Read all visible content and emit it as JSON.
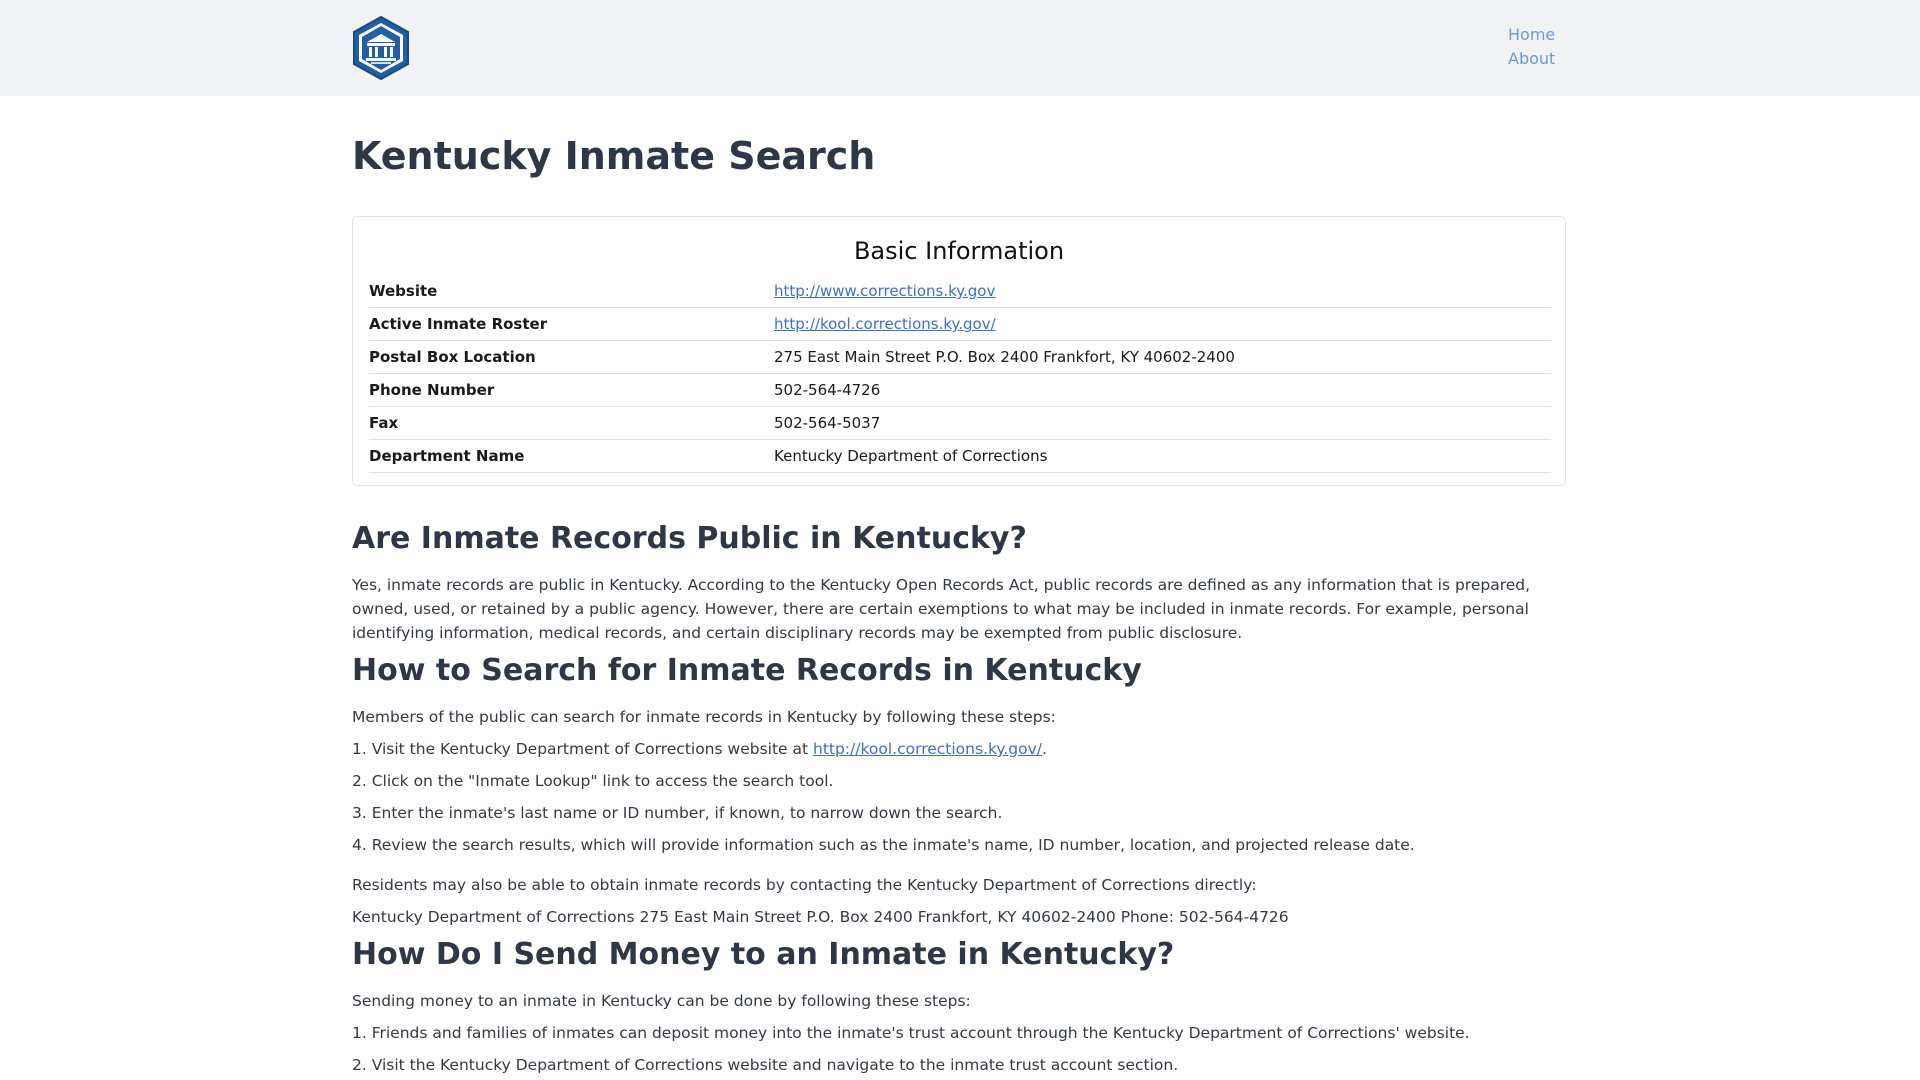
{
  "nav": {
    "logo_name": "site-logo",
    "links": [
      "Home",
      "About"
    ]
  },
  "page": {
    "title": "Kentucky Inmate Search"
  },
  "basic_info": {
    "heading": "Basic Information",
    "rows": [
      {
        "label": "Website",
        "value": "http://www.corrections.ky.gov",
        "link": true
      },
      {
        "label": "Active Inmate Roster",
        "value": "http://kool.corrections.ky.gov/",
        "link": true
      },
      {
        "label": "Postal Box Location",
        "value": "275 East Main Street P.O. Box 2400 Frankfort, KY 40602-2400",
        "link": false
      },
      {
        "label": "Phone Number",
        "value": "502-564-4726",
        "link": false
      },
      {
        "label": "Fax",
        "value": "502-564-5037",
        "link": false
      },
      {
        "label": "Department Name",
        "value": "Kentucky Department of Corrections",
        "link": false
      }
    ]
  },
  "sections": {
    "public": {
      "heading": "Are Inmate Records Public in Kentucky?",
      "body": "Yes, inmate records are public in Kentucky. According to the Kentucky Open Records Act, public records are defined as any information that is prepared, owned, used, or retained by a public agency. However, there are certain exemptions to what may be included in inmate records. For example, personal identifying information, medical records, and certain disciplinary records may be exempted from public disclosure."
    },
    "search": {
      "heading": "How to Search for Inmate Records in Kentucky",
      "intro": "Members of the public can search for inmate records in Kentucky by following these steps:",
      "step1_prefix": "1. Visit the Kentucky Department of Corrections website at ",
      "step1_link": "http://kool.corrections.ky.gov/",
      "step1_suffix": ".",
      "step2": "2. Click on the \"Inmate Lookup\" link to access the search tool.",
      "step3": "3. Enter the inmate's last name or ID number, if known, to narrow down the search.",
      "step4": "4. Review the search results, which will provide information such as the inmate's name, ID number, location, and projected release date.",
      "contact_intro": "Residents may also be able to obtain inmate records by contacting the Kentucky Department of Corrections directly:",
      "contact": "Kentucky Department of Corrections 275 East Main Street P.O. Box 2400 Frankfort, KY 40602-2400 Phone: 502-564-4726"
    },
    "money": {
      "heading": "How Do I Send Money to an Inmate in Kentucky?",
      "intro": "Sending money to an inmate in Kentucky can be done by following these steps:",
      "step1": "1. Friends and families of inmates can deposit money into the inmate's trust account through the Kentucky Department of Corrections' website.",
      "step2": "2. Visit the Kentucky Department of Corrections website and navigate to the inmate trust account section."
    }
  },
  "colors": {
    "nav_bg": "#f1f2f4",
    "link": "#3b6fd1",
    "nav_link": "#6b9bd8",
    "heading": "#2d3748"
  }
}
